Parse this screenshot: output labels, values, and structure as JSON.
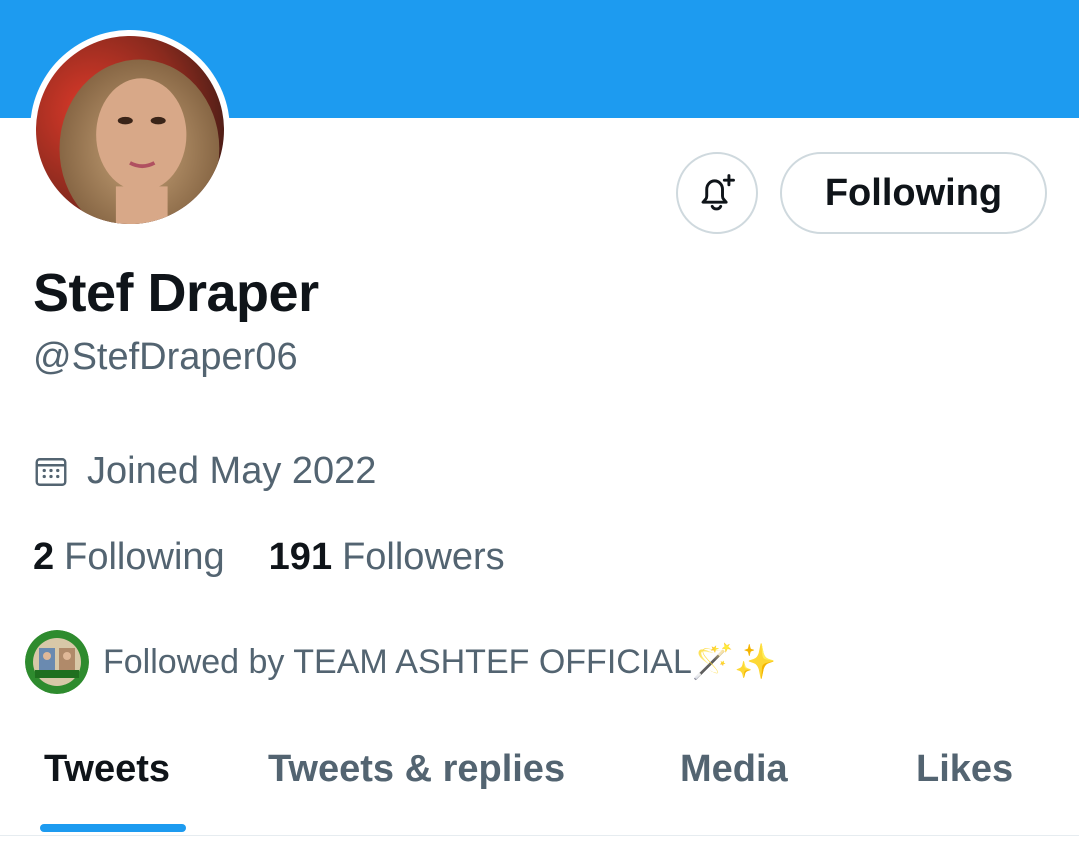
{
  "colors": {
    "banner": "#1d9bf0",
    "accent": "#1d9bf0",
    "text_primary": "#0f1419",
    "text_secondary": "#536471",
    "border": "#cfd9de"
  },
  "profile": {
    "name": "Stef Draper",
    "handle": "@StefDraper06",
    "joined": "Joined May 2022",
    "avatar_icon": "profile-photo"
  },
  "actions": {
    "notify_icon": "bell-plus-icon",
    "following_label": "Following"
  },
  "stats": {
    "following_count": "2",
    "following_label": "Following",
    "followers_count": "191",
    "followers_label": "Followers"
  },
  "followed_by": {
    "text": "Followed by TEAM ASHTEF OFFICIAL🪄✨"
  },
  "tabs": [
    {
      "label": "Tweets",
      "active": true
    },
    {
      "label": "Tweets & replies",
      "active": false
    },
    {
      "label": "Media",
      "active": false
    },
    {
      "label": "Likes",
      "active": false
    }
  ]
}
